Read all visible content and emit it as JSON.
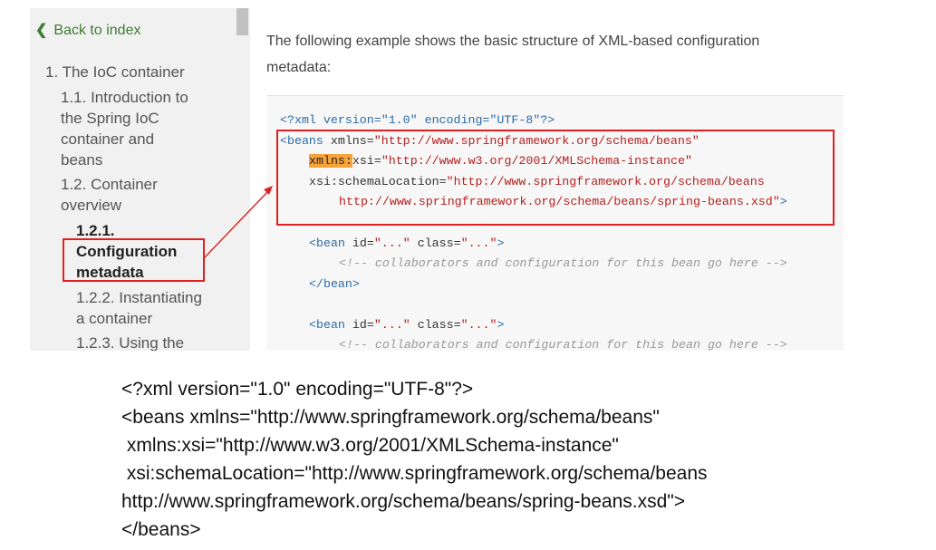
{
  "sidebar": {
    "back_label": "Back to index",
    "back_icon": "chevron-left",
    "items": [
      {
        "label": "1. The IoC container"
      },
      {
        "label": "1.1. Introduction to"
      },
      {
        "label": "the Spring IoC"
      },
      {
        "label": "container and"
      },
      {
        "label": "beans"
      },
      {
        "label": "1.2. Container"
      },
      {
        "label": "overview"
      },
      {
        "label": "1.2.1."
      },
      {
        "label": "Configuration"
      },
      {
        "label": "metadata"
      },
      {
        "label": "1.2.2. Instantiating"
      },
      {
        "label": "a container"
      },
      {
        "label": "1.2.3. Using the"
      }
    ]
  },
  "content": {
    "intro_line1": "The following example shows the basic structure of XML-based configuration",
    "intro_line2": "metadata:",
    "code": {
      "l1": "<?xml version=\"1.0\" encoding=\"UTF-8\"?>",
      "l2_tag": "<beans",
      "l2_attr": " xmlns=",
      "l2_str": "\"http://www.springframework.org/schema/beans\"",
      "l3_hl": "xmlns:",
      "l3_attr": "xsi=",
      "l3_str": "\"http://www.w3.org/2001/XMLSchema-instance\"",
      "l4_attr": "xsi:schemaLocation=",
      "l4_str": "\"http://www.springframework.org/schema/beans",
      "l5_str": "http://www.springframework.org/schema/beans/spring-beans.xsd\"",
      "l5_tag": ">",
      "l6_tag1": "<bean",
      "l6_attr1": " id=",
      "l6_str1": "\"...\"",
      "l6_attr2": " class=",
      "l6_str2": "\"...\"",
      "l6_tag2": ">",
      "l7_cmt": "<!-- collaborators and configuration for this bean go here -->",
      "l8_tag": "</bean>",
      "l9_tag1": "<bean",
      "l9_attr1": " id=",
      "l9_str1": "\"...\"",
      "l9_attr2": " class=",
      "l9_str2": "\"...\"",
      "l9_tag2": ">",
      "l10_cmt": "<!-- collaborators and configuration for this bean go here -->"
    }
  },
  "below": {
    "lines": [
      "<?xml version=\"1.0\" encoding=\"UTF-8\"?>",
      "<beans xmlns=\"http://www.springframework.org/schema/beans\"",
      " xmlns:xsi=\"http://www.w3.org/2001/XMLSchema-instance\"",
      " xsi:schemaLocation=\"http://www.springframework.org/schema/beans",
      "http://www.springframework.org/schema/beans/spring-beans.xsd\">",
      "</beans>"
    ]
  },
  "colors": {
    "annotation_red": "#e02020",
    "highlight_orange": "#f7a33a",
    "link_green": "#3e7d33"
  }
}
